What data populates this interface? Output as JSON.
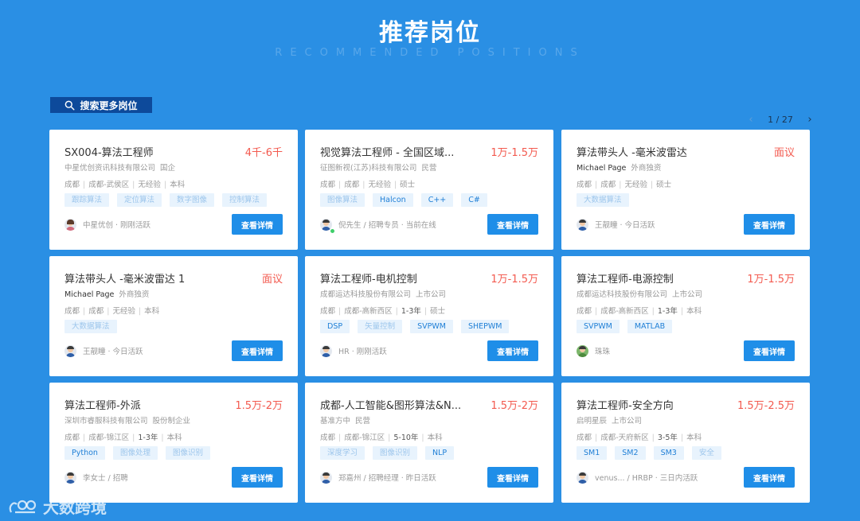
{
  "header": {
    "title": "推荐岗位",
    "subtitle": "RECOMMENDED POSITIONS"
  },
  "search": {
    "label": "搜索更多岗位",
    "icon": "search-icon"
  },
  "pager": {
    "prev_icon": "chevron-left-icon",
    "next_icon": "chevron-right-icon",
    "text": "1 / 27"
  },
  "colors": {
    "background": "#2a8fe4",
    "salary": "#f35a4f",
    "button": "#1f8ee8",
    "search_button": "#0d4a9b"
  },
  "detail_label": "查看详情",
  "jobs": [
    {
      "title": "SX004-算法工程师",
      "salary": "4千-6千",
      "company": "中星优创资讯科技有限公司",
      "company_type": "国企",
      "meta": [
        "成都",
        "成都-武侯区",
        "无经验",
        "本科"
      ],
      "tags": [
        [
          "跟踪算法",
          false
        ],
        [
          "定位算法",
          false
        ],
        [
          "数字图像",
          false
        ],
        [
          "控制算法",
          false
        ]
      ],
      "recruiter": "中星优创 · 刚刚活跃"
    },
    {
      "title": "视觉算法工程师 - 全国区域...",
      "salary": "1万-1.5万",
      "company": "征图新视(江苏)科技有限公司",
      "company_type": "民营",
      "meta": [
        "成都",
        "成都",
        "无经验",
        "硕士"
      ],
      "tags": [
        [
          "图像算法",
          false
        ],
        [
          "Halcon",
          true
        ],
        [
          "C++",
          true
        ],
        [
          "C#",
          true
        ]
      ],
      "recruiter": "倪先生 / 招聘专员 · 当前在线"
    },
    {
      "title": "算法带头人 -毫米波雷达",
      "salary": "面议",
      "company": "Michael Page",
      "company_type": "外商独资",
      "meta": [
        "成都",
        "成都",
        "无经验",
        "硕士"
      ],
      "tags": [
        [
          "大数据算法",
          false
        ]
      ],
      "recruiter": "王靓瞳 · 今日活跃"
    },
    {
      "title": "算法带头人 -毫米波雷达 1",
      "salary": "面议",
      "company": "Michael Page",
      "company_type": "外商独资",
      "meta": [
        "成都",
        "成都",
        "无经验",
        "本科"
      ],
      "tags": [
        [
          "大数据算法",
          false
        ]
      ],
      "recruiter": "王靓瞳 · 今日活跃"
    },
    {
      "title": "算法工程师-电机控制",
      "salary": "1万-1.5万",
      "company": "成都运达科技股份有限公司",
      "company_type": "上市公司",
      "meta": [
        "成都",
        "成都-高新西区",
        "1-3年",
        "硕士"
      ],
      "tags": [
        [
          "DSP",
          true
        ],
        [
          "矢量控制",
          false
        ],
        [
          "SVPWM",
          true
        ],
        [
          "SHEPWM",
          true
        ]
      ],
      "recruiter": "HR · 刚刚活跃"
    },
    {
      "title": "算法工程师-电源控制",
      "salary": "1万-1.5万",
      "company": "成都运达科技股份有限公司",
      "company_type": "上市公司",
      "meta": [
        "成都",
        "成都-高新西区",
        "1-3年",
        "本科"
      ],
      "tags": [
        [
          "SVPWM",
          true
        ],
        [
          "MATLAB",
          true
        ]
      ],
      "recruiter": "珠珠"
    },
    {
      "title": "算法工程师-外派",
      "salary": "1.5万-2万",
      "company": "深圳市睿服科技有限公司",
      "company_type": "股份制企业",
      "meta": [
        "成都",
        "成都-锦江区",
        "1-3年",
        "本科"
      ],
      "tags": [
        [
          "Python",
          true
        ],
        [
          "图像处理",
          false
        ],
        [
          "图像识别",
          false
        ]
      ],
      "recruiter": "李女士 / 招聘"
    },
    {
      "title": "成都-人工智能&图形算法&N...",
      "salary": "1.5万-2万",
      "company": "基准方中",
      "company_type": "民营",
      "meta": [
        "成都",
        "成都-锦江区",
        "5-10年",
        "本科"
      ],
      "tags": [
        [
          "深度学习",
          false
        ],
        [
          "图像识别",
          false
        ],
        [
          "NLP",
          true
        ]
      ],
      "recruiter": "郑嘉州 / 招聘经理 · 昨日活跃"
    },
    {
      "title": "算法工程师-安全方向",
      "salary": "1.5万-2.5万",
      "company": "启明星辰",
      "company_type": "上市公司",
      "meta": [
        "成都",
        "成都-天府新区",
        "3-5年",
        "本科"
      ],
      "tags": [
        [
          "SM1",
          true
        ],
        [
          "SM2",
          true
        ],
        [
          "SM3",
          true
        ],
        [
          "安全",
          false
        ]
      ],
      "recruiter": "venus... / HRBP · 三日内活跃"
    }
  ],
  "logo": {
    "text": "大数跨境",
    "icon": "cloud-logo-icon"
  }
}
